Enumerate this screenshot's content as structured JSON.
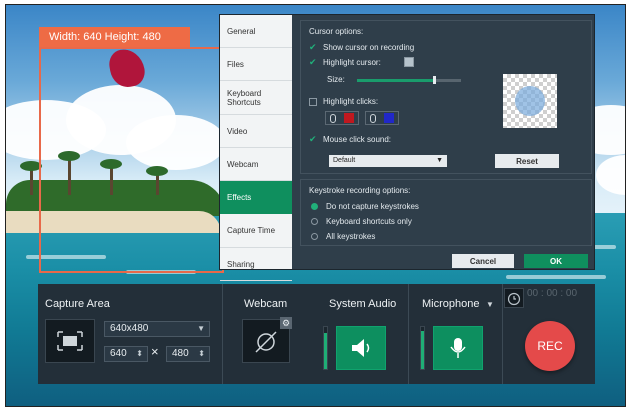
{
  "capture_frame": {
    "label": "Width: 640  Height: 480"
  },
  "settings": {
    "nav": [
      "General",
      "Files",
      "Keyboard Shortcuts",
      "Video",
      "Webcam",
      "Effects",
      "Capture Time",
      "Sharing"
    ],
    "active_nav": "Effects",
    "cursor": {
      "title": "Cursor options:",
      "show_cursor": "Show cursor on recording",
      "highlight_cursor": "Highlight cursor:",
      "size_label": "Size:",
      "size_value": 0.8,
      "highlight_clicks": "Highlight clicks:",
      "left_click_color": "#c0181f",
      "right_click_color": "#2128c9",
      "mouse_click_sound": "Mouse click sound:",
      "sound_value": "Default",
      "reset_label": "Reset"
    },
    "keystrokes": {
      "title": "Keystroke recording options:",
      "options": [
        "Do not capture keystrokes",
        "Keyboard shortcuts only",
        "All keystrokes"
      ],
      "selected": "Do not capture keystrokes"
    },
    "cancel_label": "Cancel",
    "ok_label": "OK"
  },
  "bar": {
    "capture_area": "Capture Area",
    "resolution": "640x480",
    "width": "640",
    "height": "480",
    "times": "×",
    "webcam": "Webcam",
    "system_audio": "System Audio",
    "system_audio_level": 0.85,
    "microphone": "Microphone",
    "microphone_level": 0.9,
    "timer": "00 : 00 : 00",
    "rec_label": "REC"
  },
  "colors": {
    "accent": "#0f8f5e",
    "capture_orange": "#ee6b45",
    "rec_red": "#e44a4a"
  },
  "icons": [
    "fullscreen-icon",
    "webcam-off-icon",
    "gear-icon",
    "speaker-icon",
    "microphone-icon",
    "alarm-clock-icon",
    "mouse-icon",
    "chevron-down-icon"
  ]
}
